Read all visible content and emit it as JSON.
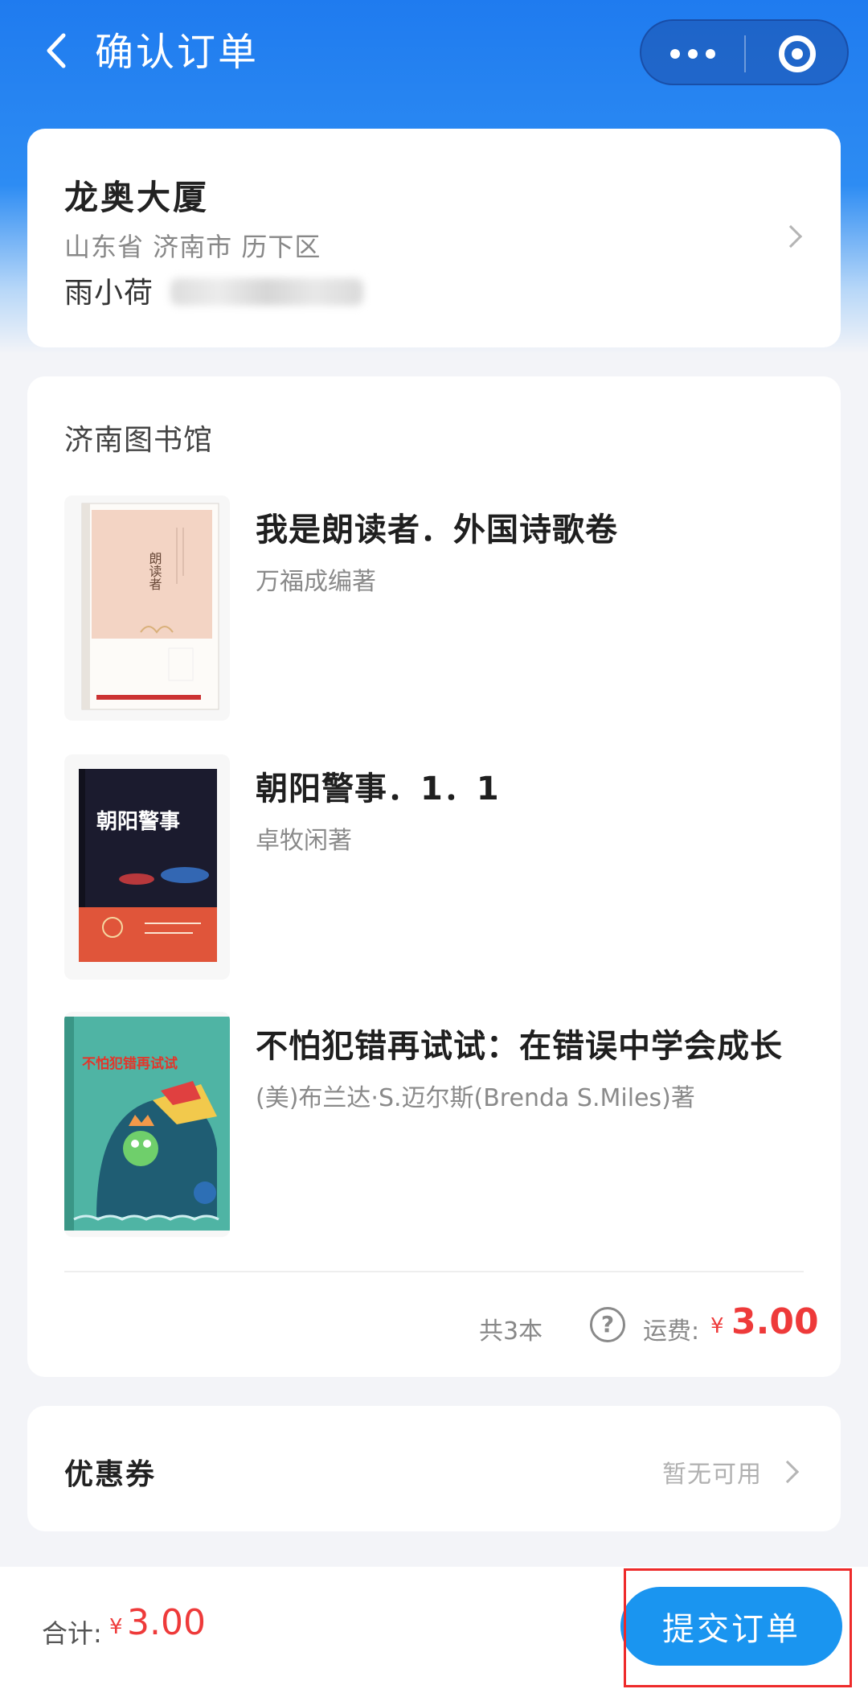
{
  "header": {
    "title": "确认订单",
    "back_icon": "chevron-left-icon",
    "more_icon": "more-dots-icon",
    "close_icon": "close-circle-icon",
    "theme_color": "#2d8cf3"
  },
  "address": {
    "name": "龙奥大厦",
    "region": "山东省 济南市 历下区",
    "contact": "雨小荷"
  },
  "library": {
    "name": "济南图书馆",
    "books": [
      {
        "title": "我是朗读者．外国诗歌卷",
        "author": "万福成编著",
        "cover_text": "朗读者"
      },
      {
        "title": "朝阳警事．1．1",
        "author": "卓牧闲著",
        "cover_text": "朝阳警事"
      },
      {
        "title": "不怕犯错再试试：在错误中学会成长",
        "author": "(美)布兰达·S.迈尔斯(Brenda S.Miles)著",
        "cover_text": "不怕犯错再试试"
      }
    ],
    "count_text": "共3本",
    "shipping_label": "运费:",
    "currency": "¥",
    "shipping_amount": "3.00"
  },
  "coupon": {
    "label": "优惠券",
    "status": "暂无可用"
  },
  "footer": {
    "total_label": "合计:",
    "currency": "¥",
    "total_amount": "3.00",
    "submit_label": "提交订单",
    "price_color": "#ee3a3a",
    "button_color": "#1a95f0"
  }
}
